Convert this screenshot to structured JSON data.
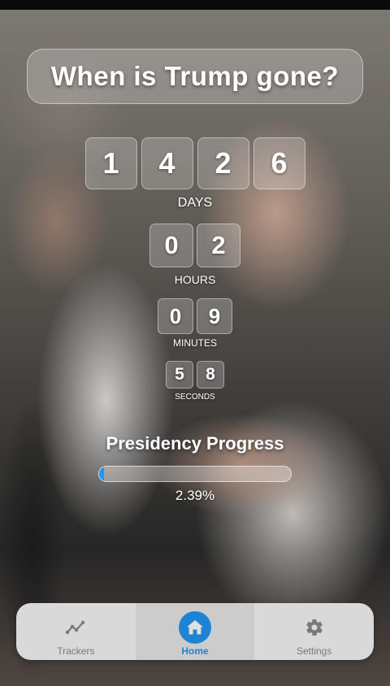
{
  "title": "When is Trump gone?",
  "countdown": {
    "days": {
      "digits": [
        "1",
        "4",
        "2",
        "6"
      ],
      "label": "DAYS"
    },
    "hours": {
      "digits": [
        "0",
        "2"
      ],
      "label": "HOURS"
    },
    "minutes": {
      "digits": [
        "0",
        "9"
      ],
      "label": "MINUTES"
    },
    "seconds": {
      "digits": [
        "5",
        "8"
      ],
      "label": "SECONDS"
    }
  },
  "progress": {
    "title": "Presidency Progress",
    "percent": 2.39,
    "text": "2.39%",
    "fill_color": "#2196f3"
  },
  "nav": {
    "items": [
      {
        "label": "Trackers",
        "icon": "chart-line-icon"
      },
      {
        "label": "Home",
        "icon": "home-icon",
        "active": true
      },
      {
        "label": "Settings",
        "icon": "gear-icon"
      }
    ],
    "accent_color": "#2196f3"
  }
}
